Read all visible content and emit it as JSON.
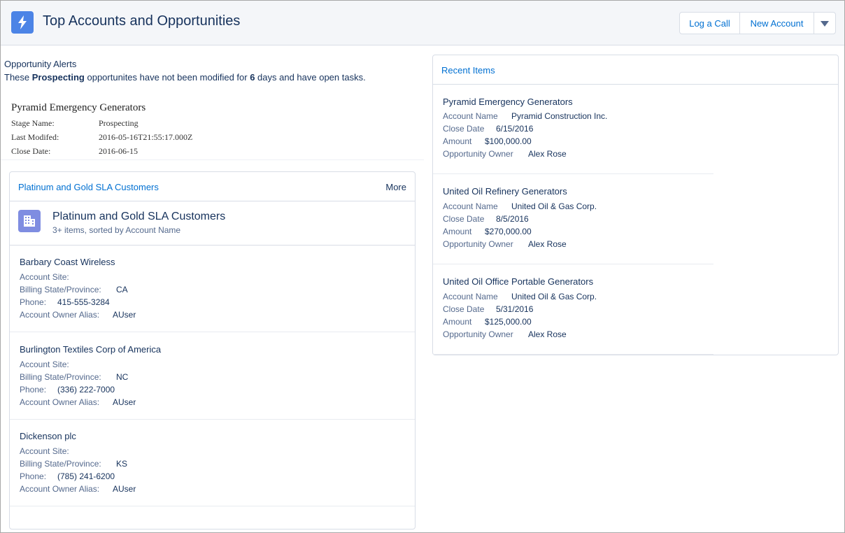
{
  "header": {
    "title": "Top Accounts and Opportunities",
    "buttons": {
      "log_call": "Log a Call",
      "new_account": "New Account"
    },
    "accent_color": "#4c84e6"
  },
  "alerts": {
    "title": "Opportunity Alerts",
    "msg_prefix": "These ",
    "msg_stage": "Prospecting",
    "msg_mid": " opportunites have not been modified for ",
    "msg_days": "6",
    "msg_suffix": " days and have open tasks.",
    "record": {
      "name": "Pyramid Emergency Generators",
      "fields": [
        {
          "label": "Stage Name:",
          "value": "Prospecting"
        },
        {
          "label": "Last Modifed:",
          "value": "2016-05-16T21:55:17.000Z"
        },
        {
          "label": "Close Date:",
          "value": "2016-06-15"
        }
      ]
    }
  },
  "listview": {
    "header_link": "Platinum and Gold SLA Customers",
    "more": "More",
    "title": "Platinum and Gold SLA Customers",
    "subtitle": "3+ items, sorted by Account Name",
    "icon_color": "#7f8de1",
    "accounts": [
      {
        "name": "Barbary Coast Wireless",
        "site_label": "Account Site:",
        "site": "",
        "state_label": "Billing State/Province:",
        "state": "CA",
        "phone_label": "Phone:",
        "phone": "415-555-3284",
        "alias_label": "Account Owner Alias:",
        "alias": "AUser"
      },
      {
        "name": "Burlington Textiles Corp of America",
        "site_label": "Account Site:",
        "site": "",
        "state_label": "Billing State/Province:",
        "state": "NC",
        "phone_label": "Phone:",
        "phone": "(336) 222-7000",
        "alias_label": "Account Owner Alias:",
        "alias": "AUser"
      },
      {
        "name": "Dickenson plc",
        "site_label": "Account Site:",
        "site": "",
        "state_label": "Billing State/Province:",
        "state": "KS",
        "phone_label": "Phone:",
        "phone": "(785) 241-6200",
        "alias_label": "Account Owner Alias:",
        "alias": "AUser"
      }
    ]
  },
  "recent": {
    "header_link": "Recent Items",
    "items": [
      {
        "name": "Pyramid Emergency Generators",
        "acct_label": "Account Name",
        "acct": "Pyramid Construction Inc.",
        "close_label": "Close Date",
        "close": "6/15/2016",
        "amount_label": "Amount",
        "amount": "$100,000.00",
        "owner_label": "Opportunity Owner",
        "owner": "Alex Rose"
      },
      {
        "name": "United Oil Refinery Generators",
        "acct_label": "Account Name",
        "acct": "United Oil & Gas Corp.",
        "close_label": "Close Date",
        "close": "8/5/2016",
        "amount_label": "Amount",
        "amount": "$270,000.00",
        "owner_label": "Opportunity Owner",
        "owner": "Alex Rose"
      },
      {
        "name": "United Oil Office Portable Generators",
        "acct_label": "Account Name",
        "acct": "United Oil & Gas Corp.",
        "close_label": "Close Date",
        "close": "5/31/2016",
        "amount_label": "Amount",
        "amount": "$125,000.00",
        "owner_label": "Opportunity Owner",
        "owner": "Alex Rose"
      }
    ]
  }
}
